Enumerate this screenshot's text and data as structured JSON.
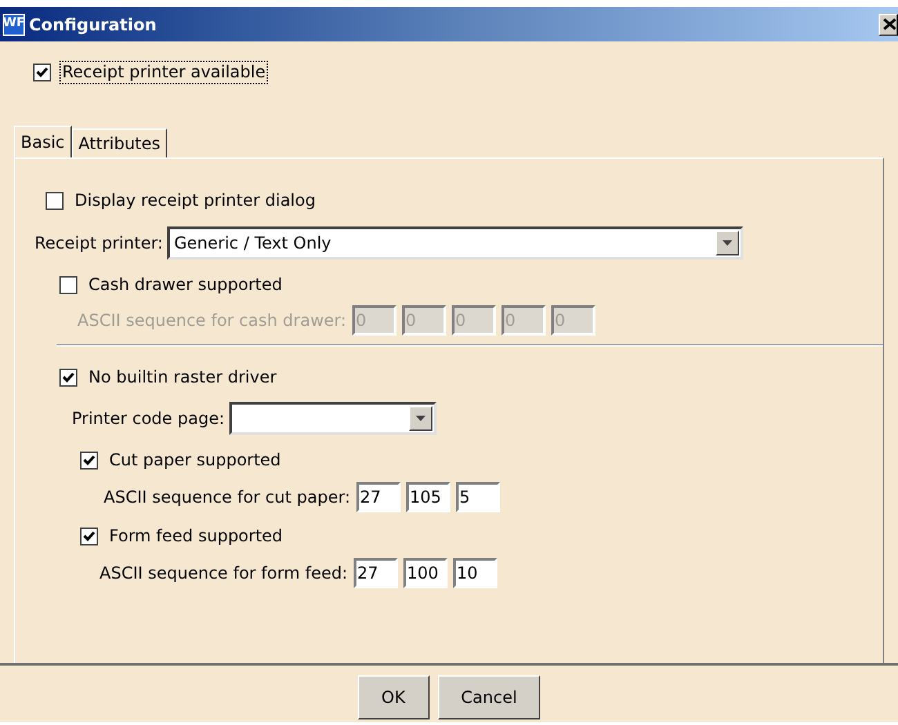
{
  "window": {
    "title": "Configuration",
    "logo": "WF"
  },
  "receipt_printer_available": {
    "label": "Receipt printer available",
    "checked": true,
    "focused": true
  },
  "tabs": [
    {
      "label": "Basic",
      "selected": true
    },
    {
      "label": "Attributes",
      "selected": false
    }
  ],
  "basic": {
    "display_dialog": {
      "label": "Display receipt printer dialog",
      "checked": false
    },
    "receipt_printer": {
      "label": "Receipt printer:",
      "value": "Generic / Text Only"
    },
    "cash_drawer": {
      "label": "Cash drawer supported",
      "checked": false
    },
    "cash_drawer_sequence": {
      "label": "ASCII sequence for cash drawer:",
      "values": [
        "0",
        "0",
        "0",
        "0",
        "0"
      ],
      "disabled": true
    },
    "no_builtin_raster": {
      "label": "No builtin raster driver",
      "checked": true
    },
    "code_page": {
      "label": "Printer code page:"
    },
    "cut_paper": {
      "label": "Cut paper supported",
      "checked": true
    },
    "cut_paper_sequence": {
      "label": "ASCII sequence for cut paper:",
      "values": [
        "27",
        "105",
        "5"
      ],
      "disabled": false
    },
    "form_feed": {
      "label": "Form feed supported",
      "checked": true
    },
    "form_feed_sequence": {
      "label": "ASCII sequence for form feed:",
      "values": [
        "27",
        "100",
        "10"
      ],
      "disabled": false
    }
  },
  "buttons": [
    "OK",
    "Cancel"
  ]
}
